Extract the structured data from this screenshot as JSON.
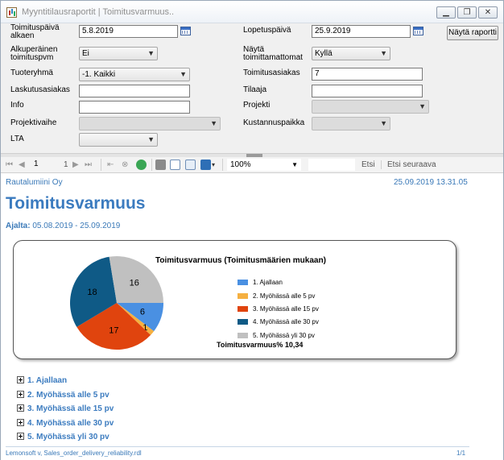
{
  "window": {
    "title": "Myyntitilausraportit | Toimitusvarmuus..",
    "buttons": {
      "minimize": "▁",
      "maximize": "❐",
      "close": "✕"
    }
  },
  "params": {
    "start_date_label": "Toimituspäivä alkaen",
    "start_date_value": "5.8.2019",
    "end_date_label": "Lopetuspäivä",
    "end_date_value": "25.9.2019",
    "original_date_label": "Alkuperäinen toimituspvm",
    "original_date_value": "Ei",
    "show_undelivered_label": "Näytä toimittamattomat",
    "show_undelivered_value": "Kyllä",
    "product_group_label": "Tuoteryhmä",
    "product_group_value": "-1. Kaikki",
    "delivery_customer_label": "Toimitusasiakas",
    "delivery_customer_value": "7",
    "invoice_customer_label": "Laskutusasiakas",
    "invoice_customer_value": "",
    "orderer_label": "Tilaaja",
    "orderer_value": "",
    "info_label": "Info",
    "info_value": "",
    "project_label": "Projekti",
    "project_value": "",
    "project_phase_label": "Projektivaihe",
    "project_phase_value": "",
    "cost_center_label": "Kustannuspaikka",
    "cost_center_value": "",
    "lta_label": "LTA",
    "lta_value": "",
    "view_report_label": "Näytä raportti"
  },
  "toolbar": {
    "page_current": "1",
    "page_total": "1",
    "zoom_value": "100%",
    "find_label": "Etsi",
    "find_next_label": "Etsi seuraava"
  },
  "report": {
    "company": "Rautalumiini Oy",
    "timestamp": "25.09.2019 13.31.05",
    "title": "Toimitusvarmuus",
    "period_label": "Ajalta:",
    "period_value": "05.08.2019 - 25.09.2019",
    "groups": [
      "1. Ajallaan",
      "2. Myöhässä alle 5 pv",
      "3. Myöhässä alle 15 pv",
      "4. Myöhässä alle 30 pv",
      "5. Myöhässä yli 30 pv"
    ],
    "footer_left": "Lemonsoft v, Sales_order_delivery_reliability.rdl",
    "footer_right": "1/1"
  },
  "colors": {
    "accent": "#3b7bbf",
    "slice_1": "#4a90e2",
    "slice_2": "#f5b041",
    "slice_3": "#e0440e",
    "slice_4": "#0f5a86",
    "slice_5": "#c0c0c0"
  },
  "chart_data": {
    "type": "pie",
    "title": "Toimitusvarmuus (Toimitusmäärien mukaan)",
    "categories": [
      "1. Ajallaan",
      "2. Myöhässä alle 5 pv",
      "3. Myöhässä alle 15 pv",
      "4. Myöhässä alle 30 pv",
      "5. Myöhässä yli 30 pv"
    ],
    "values": [
      6,
      1,
      17,
      18,
      16
    ],
    "colors": [
      "#4a90e2",
      "#f5b041",
      "#e0440e",
      "#0f5a86",
      "#c0c0c0"
    ],
    "legend": "right",
    "summary_label": "Toimitusvarmuus%",
    "summary_value": "10,34"
  }
}
